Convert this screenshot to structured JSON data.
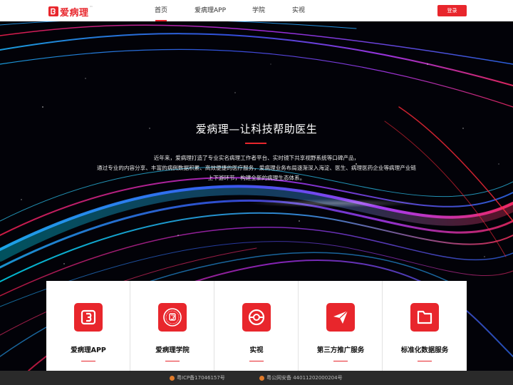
{
  "header": {
    "logo_text": "爱病理",
    "logo_tm": "™",
    "nav": [
      {
        "label": "首页",
        "active": true
      },
      {
        "label": "爱病理APP",
        "active": false
      },
      {
        "label": "学院",
        "active": false
      },
      {
        "label": "实视",
        "active": false
      }
    ],
    "login_label": "登录"
  },
  "hero": {
    "title": "爱病理—让科技帮助医生",
    "description_lines": [
      "近年来，爱病理打造了专业实名病理工作者平台、实时镜下共享视野系统等口碑产品，",
      "通过专业的内容分享、丰富的病例数据积累、高效便捷的医疗服务，爱病理业务布局逐渐深入海淀、医生、病理医药企业等病理产业链",
      "上下游环节，构建全新的病理生态体系。"
    ]
  },
  "cards": [
    {
      "label": "爱病理APP",
      "icon": "app-logo-icon"
    },
    {
      "label": "爱病理学院",
      "icon": "academy-seal-icon"
    },
    {
      "label": "实视",
      "icon": "live-view-icon"
    },
    {
      "label": "第三方推广服务",
      "icon": "paper-plane-icon"
    },
    {
      "label": "标准化数据服务",
      "icon": "folder-icon"
    }
  ],
  "footer": {
    "icp": "粤ICP备17046157号",
    "police": "粤公网安备 44011202000204号"
  },
  "colors": {
    "brand_red": "#e8262c",
    "footer_bg": "#2a2a2a"
  }
}
